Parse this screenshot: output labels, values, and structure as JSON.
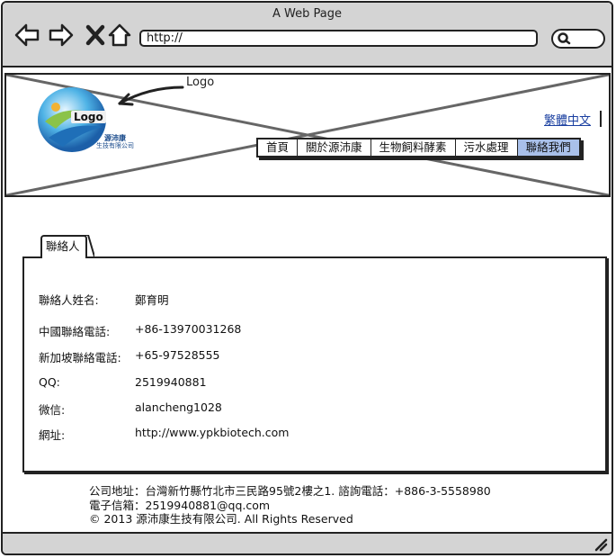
{
  "window": {
    "title": "A Web Page"
  },
  "browser": {
    "url": "http://",
    "back_icon": "back-arrow-icon",
    "forward_icon": "forward-arrow-icon",
    "close_icon": "close-x-icon",
    "home_icon": "home-icon",
    "search_icon": "search-icon"
  },
  "header": {
    "logo_label": "Logo",
    "logo_annotation": "Logo",
    "brand_line1": "源沛康",
    "brand_line2": "生技有限公司",
    "language_link": "繁體中文"
  },
  "nav": {
    "items": [
      {
        "label": "首頁",
        "active": false
      },
      {
        "label": "關於源沛康",
        "active": false
      },
      {
        "label": "生物飼料酵素",
        "active": false
      },
      {
        "label": "污水處理",
        "active": false
      },
      {
        "label": "聯絡我們",
        "active": true
      }
    ],
    "active_color": "#a9c0ea"
  },
  "contact": {
    "tab_label": "聯絡人",
    "rows": [
      {
        "label": "聯絡人姓名:",
        "value": "鄭育明"
      },
      {
        "label": "中國聯絡電話:",
        "value": "+86-13970031268"
      },
      {
        "label": "新加坡聯絡電話:",
        "value": "+65-97528555"
      },
      {
        "label": "QQ:",
        "value": "2519940881"
      },
      {
        "label": "微信:",
        "value": "alancheng1028"
      },
      {
        "label": "網址:",
        "value": "http://www.ypkbiotech.com"
      }
    ]
  },
  "footer": {
    "line1": "公司地址：台灣新竹縣竹北市三民路95號2樓之1. 諮詢電話：+886-3-5558980",
    "line2": "電子信箱：2519940881@qq.com",
    "line3": "© 2013 源沛康生技有限公司. All Rights Reserved"
  }
}
